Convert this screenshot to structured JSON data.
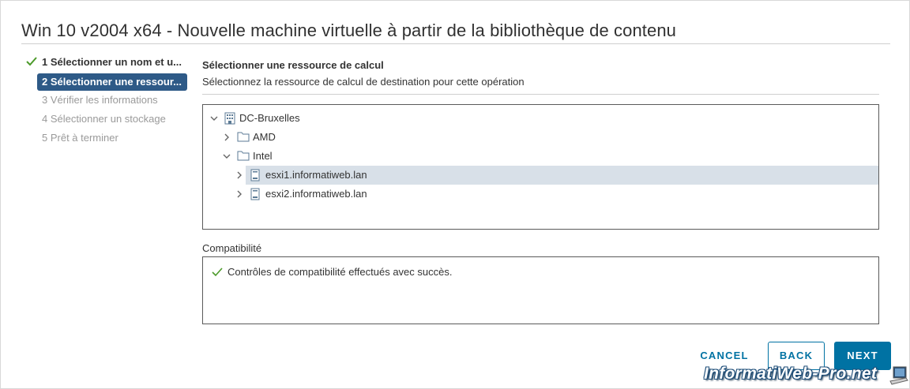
{
  "dialog": {
    "title": "Win 10 v2004 x64 - Nouvelle machine virtuelle à partir de la bibliothèque de contenu"
  },
  "steps": [
    {
      "label": "1 Sélectionner un nom et u...",
      "state": "done"
    },
    {
      "label": "2 Sélectionner une ressour...",
      "state": "active"
    },
    {
      "label": "3 Vérifier les informations",
      "state": "pending"
    },
    {
      "label": "4 Sélectionner un stockage",
      "state": "pending"
    },
    {
      "label": "5 Prêt à terminer",
      "state": "pending"
    }
  ],
  "main": {
    "title": "Sélectionner une ressource de calcul",
    "description": "Sélectionnez la ressource de calcul de destination pour cette opération"
  },
  "tree": {
    "nodes": [
      {
        "label": "DC-Bruxelles",
        "icon": "datacenter-icon",
        "expanded": true
      },
      {
        "label": "AMD",
        "icon": "folder-icon",
        "expanded": false
      },
      {
        "label": "Intel",
        "icon": "folder-icon",
        "expanded": true
      },
      {
        "label": "esxi1.informatiweb.lan",
        "icon": "host-icon",
        "expanded": false,
        "selected": true
      },
      {
        "label": "esxi2.informatiweb.lan",
        "icon": "host-icon",
        "expanded": false
      }
    ]
  },
  "compatibility": {
    "label": "Compatibilité",
    "message": "Contrôles de compatibilité effectués avec succès."
  },
  "buttons": {
    "cancel": "CANCEL",
    "back": "BACK",
    "next": "NEXT"
  },
  "watermark": {
    "text": "InformatiWeb-Pro.net"
  },
  "colors": {
    "accent": "#0072a3",
    "step_active_bg": "#2e5a87",
    "success": "#4c9a2a",
    "selected_row": "#d8e0e8"
  }
}
